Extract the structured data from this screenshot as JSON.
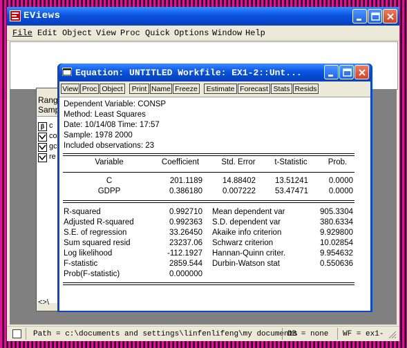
{
  "app": {
    "title": "EViews",
    "menu": [
      "File",
      "Edit",
      "Object",
      "View",
      "Proc",
      "Quick",
      "Options",
      "Window",
      "Help"
    ]
  },
  "workfile": {
    "range_label": "Rang",
    "sample_label": "Samp",
    "objects": [
      {
        "name": "c",
        "icon": "beta-icon"
      },
      {
        "name": "co",
        "icon": "series-icon"
      },
      {
        "name": "gc",
        "icon": "series-icon"
      },
      {
        "name": "re",
        "icon": "series-icon"
      }
    ],
    "tab_nav": "<>\\"
  },
  "equation": {
    "title": "Equation: UNTITLED   Workfile: EX1-2::Unt...",
    "toolbar": [
      "View",
      "Proc",
      "Object",
      "Print",
      "Name",
      "Freeze",
      "Estimate",
      "Forecast",
      "Stats",
      "Resids"
    ],
    "header": [
      "Dependent Variable: CONSP",
      "Method: Least Squares",
      "Date: 10/14/08   Time: 17:57",
      "Sample: 1978 2000",
      "Included observations: 23"
    ],
    "columns": [
      "Variable",
      "Coefficient",
      "Std. Error",
      "t-Statistic",
      "Prob."
    ],
    "rows": [
      {
        "var": "C",
        "coef": "201.1189",
        "se": "14.88402",
        "t": "13.51241",
        "p": "0.0000"
      },
      {
        "var": "GDPP",
        "coef": "0.386180",
        "se": "0.007222",
        "t": "53.47471",
        "p": "0.0000"
      }
    ],
    "stats_left": [
      {
        "label": "R-squared",
        "value": "0.992710"
      },
      {
        "label": "Adjusted R-squared",
        "value": "0.992363"
      },
      {
        "label": "S.E. of regression",
        "value": "33.26450"
      },
      {
        "label": "Sum squared resid",
        "value": "23237.06"
      },
      {
        "label": "Log likelihood",
        "value": "-112.1927"
      },
      {
        "label": "F-statistic",
        "value": "2859.544"
      },
      {
        "label": "Prob(F-statistic)",
        "value": "0.000000"
      }
    ],
    "stats_right": [
      {
        "label": "Mean dependent var",
        "value": "905.3304"
      },
      {
        "label": "S.D. dependent var",
        "value": "380.6334"
      },
      {
        "label": "Akaike info criterion",
        "value": "9.929800"
      },
      {
        "label": "Schwarz criterion",
        "value": "10.02854"
      },
      {
        "label": "Hannan-Quinn criter.",
        "value": "9.954632"
      },
      {
        "label": "Durbin-Watson stat",
        "value": "0.550636"
      }
    ]
  },
  "statusbar": {
    "path": "Path = c:\\documents and settings\\linfenlifeng\\my documents",
    "db": "DB = none",
    "wf": "WF = ex1-"
  }
}
